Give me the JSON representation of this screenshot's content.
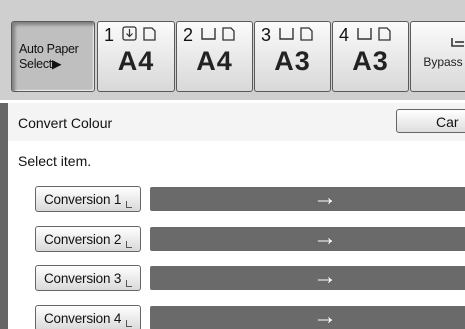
{
  "trays": {
    "auto": {
      "label": "Auto Paper\nSelect▶"
    },
    "items": [
      {
        "number": "1",
        "size": "A4"
      },
      {
        "number": "2",
        "size": "A4"
      },
      {
        "number": "3",
        "size": "A3"
      },
      {
        "number": "4",
        "size": "A3"
      }
    ],
    "bypass": {
      "label": "Bypass"
    }
  },
  "panel": {
    "title": "Convert Colour",
    "cancel_label": "Car",
    "instruction": "Select item."
  },
  "conversions": [
    {
      "label": "Conversion 1",
      "arrow": "→"
    },
    {
      "label": "Conversion 2",
      "arrow": "→"
    },
    {
      "label": "Conversion 3",
      "arrow": "→"
    },
    {
      "label": "Conversion 4",
      "arrow": "→"
    }
  ],
  "colors": {
    "tray_bar": "#cfcfcf",
    "conversion_bar": "#6a6a6a",
    "arrow": "#ffffff"
  }
}
